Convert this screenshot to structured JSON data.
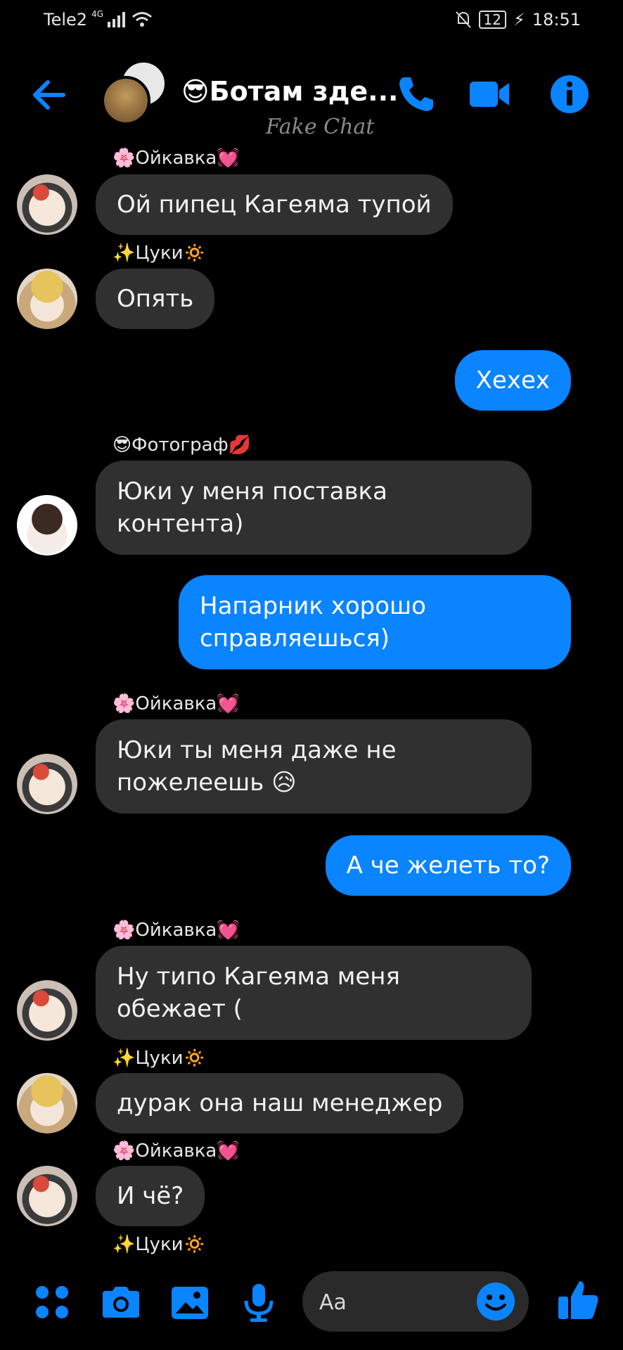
{
  "status": {
    "carrier": "Tele2",
    "network": "4G",
    "battery": "12",
    "time": "18:51"
  },
  "header": {
    "title": "😎Ботам зде...",
    "watermark": "Fake Chat"
  },
  "messages": [
    {
      "sender": "🌸Ойкавка💓",
      "text_lines": [
        "Ой пипец Кагеяма тупой"
      ]
    },
    {
      "sender": "✨Цуки🔅",
      "text_lines": [
        "Опять"
      ]
    },
    {
      "text_lines": [
        "Хехех"
      ]
    },
    {
      "sender": "😎Фотограф💋",
      "text_lines": [
        "Юки у меня поставка",
        "контента)"
      ]
    },
    {
      "text_lines": [
        "Напарник хорошо",
        "справляешься)"
      ]
    },
    {
      "sender": "🌸Ойкавка💓",
      "text_lines": [
        "Юки ты меня даже не",
        "пожелеешь 😥"
      ]
    },
    {
      "text_lines": [
        "А че желеть то?"
      ]
    },
    {
      "sender": "🌸Ойкавка💓",
      "text_lines": [
        "Ну типо Кагеяма меня",
        "обежает ("
      ]
    },
    {
      "sender": "✨Цуки🔅",
      "text_lines": [
        "дурак она наш менеджер"
      ]
    },
    {
      "sender": "🌸Ойкавка💓",
      "text_lines": [
        "И чё?"
      ]
    },
    {
      "sender": "✨Цуки🔅"
    }
  ],
  "composer": {
    "placeholder": "Aa"
  },
  "icons": {
    "header": [
      "back-arrow-icon",
      "phone-icon",
      "video-camera-icon",
      "info-icon"
    ],
    "toolbar": [
      "apps-icon",
      "camera-icon",
      "gallery-icon",
      "microphone-icon",
      "emoji-icon",
      "like-thumb-icon"
    ],
    "accent": "#0a84ff"
  }
}
